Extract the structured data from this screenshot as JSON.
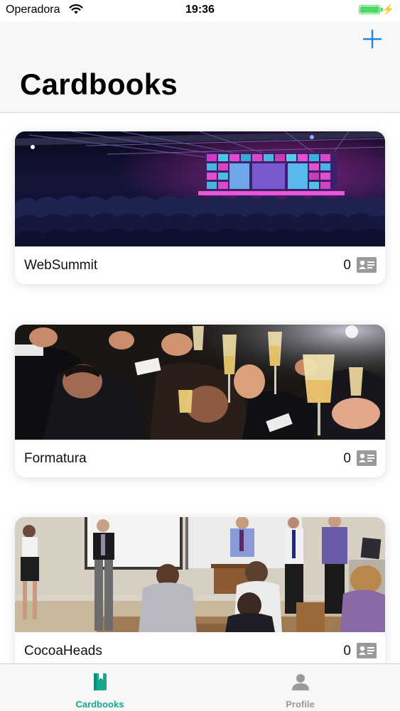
{
  "status_bar": {
    "carrier": "Operadora",
    "time": "19:36"
  },
  "header": {
    "title": "Cardbooks",
    "add_icon": "plus-icon"
  },
  "cards": [
    {
      "name": "WebSummit",
      "count": "0",
      "image": "conference-hall-photo"
    },
    {
      "name": "Formatura",
      "count": "0",
      "image": "champagne-toast-photo"
    },
    {
      "name": "CocoaHeads",
      "count": "0",
      "image": "meetup-classroom-photo"
    }
  ],
  "tabbar": {
    "tabs": [
      {
        "label": "Cardbooks",
        "icon": "book-icon",
        "active": true
      },
      {
        "label": "Profile",
        "icon": "person-icon",
        "active": false
      }
    ]
  },
  "colors": {
    "accent": "#1a84e8",
    "tab_active": "#17a68f",
    "tab_inactive": "#9a9a9a"
  }
}
